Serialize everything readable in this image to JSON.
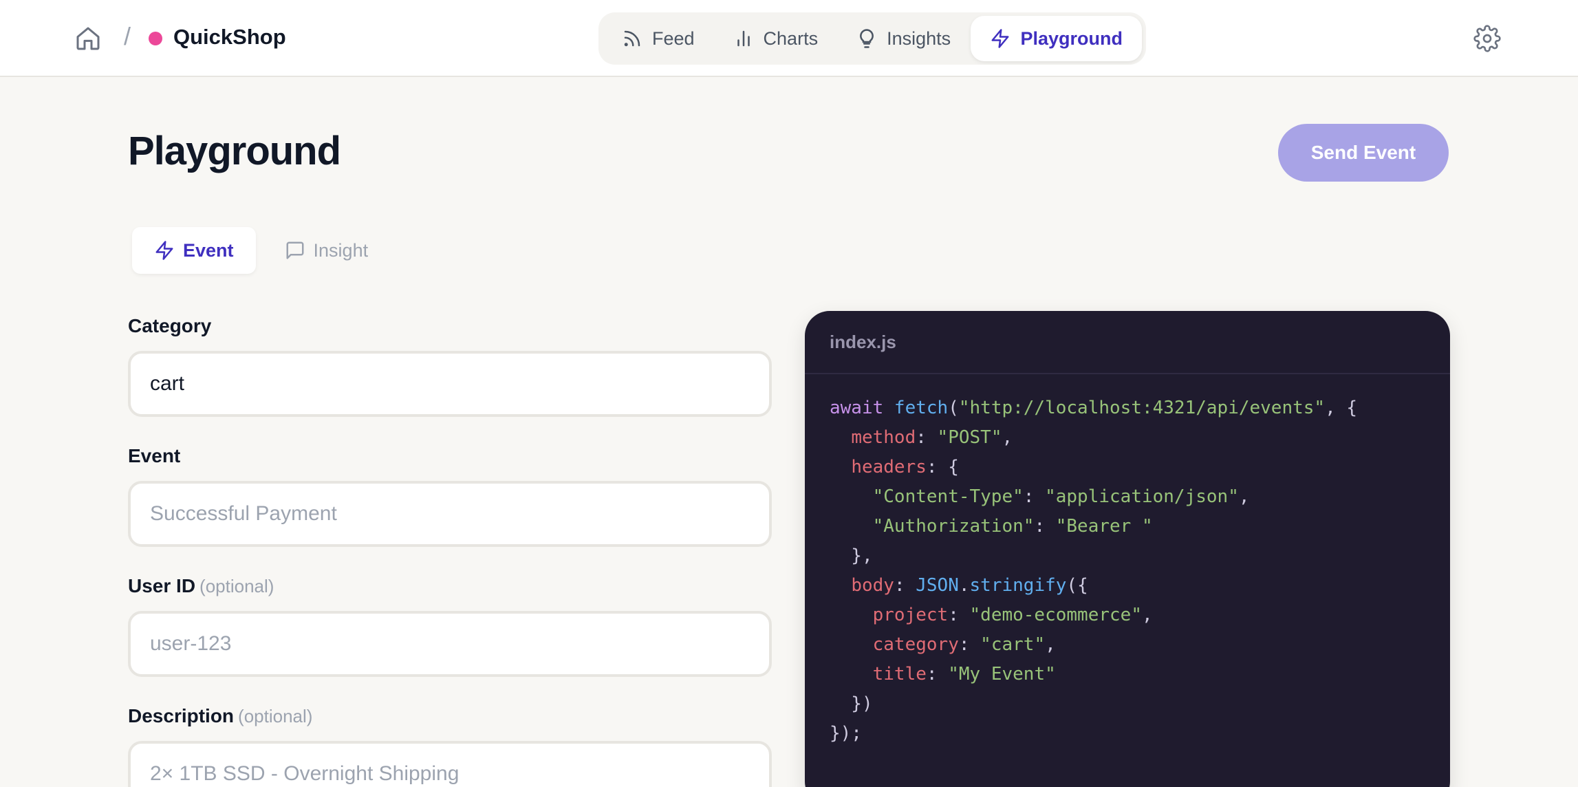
{
  "header": {
    "project_name": "QuickShop",
    "project_color": "#ec4899",
    "separator": "/",
    "nav": [
      {
        "label": "Feed",
        "icon": "rss-icon"
      },
      {
        "label": "Charts",
        "icon": "bar-chart-icon"
      },
      {
        "label": "Insights",
        "icon": "lightbulb-icon"
      },
      {
        "label": "Playground",
        "icon": "bolt-icon",
        "active": true
      }
    ]
  },
  "page": {
    "title": "Playground",
    "send_button": "Send Event",
    "accent_color": "#3f2fbf"
  },
  "tabs": [
    {
      "label": "Event",
      "icon": "bolt-icon",
      "active": true
    },
    {
      "label": "Insight",
      "icon": "message-square-icon",
      "active": false
    }
  ],
  "form": {
    "category": {
      "label": "Category",
      "value": "cart"
    },
    "event": {
      "label": "Event",
      "placeholder": "Successful Payment"
    },
    "user_id": {
      "label": "User ID",
      "optional": "(optional)",
      "placeholder": "user-123"
    },
    "description": {
      "label": "Description",
      "optional": "(optional)",
      "placeholder": "2× 1TB SSD - Overnight Shipping"
    }
  },
  "code": {
    "filename": "index.js",
    "lines": [
      [
        [
          "k",
          "await "
        ],
        [
          "f",
          "fetch"
        ],
        [
          "n",
          "("
        ],
        [
          "s",
          "\"http://localhost:4321/api/events\""
        ],
        [
          "n",
          ", {"
        ]
      ],
      [
        [
          "n",
          "  "
        ],
        [
          "p",
          "method"
        ],
        [
          "n",
          ": "
        ],
        [
          "s",
          "\"POST\""
        ],
        [
          "n",
          ","
        ]
      ],
      [
        [
          "n",
          "  "
        ],
        [
          "p",
          "headers"
        ],
        [
          "n",
          ": {"
        ]
      ],
      [
        [
          "n",
          "    "
        ],
        [
          "s",
          "\"Content-Type\""
        ],
        [
          "n",
          ": "
        ],
        [
          "s",
          "\"application/json\""
        ],
        [
          "n",
          ","
        ]
      ],
      [
        [
          "n",
          "    "
        ],
        [
          "s",
          "\"Authorization\""
        ],
        [
          "n",
          ": "
        ],
        [
          "s",
          "\"Bearer \""
        ]
      ],
      [
        [
          "n",
          "  },"
        ]
      ],
      [
        [
          "n",
          "  "
        ],
        [
          "p",
          "body"
        ],
        [
          "n",
          ": "
        ],
        [
          "f",
          "JSON"
        ],
        [
          "n",
          "."
        ],
        [
          "f",
          "stringify"
        ],
        [
          "n",
          "({"
        ]
      ],
      [
        [
          "n",
          "    "
        ],
        [
          "p",
          "project"
        ],
        [
          "n",
          ": "
        ],
        [
          "s",
          "\"demo-ecommerce\""
        ],
        [
          "n",
          ","
        ]
      ],
      [
        [
          "n",
          "    "
        ],
        [
          "p",
          "category"
        ],
        [
          "n",
          ": "
        ],
        [
          "s",
          "\"cart\""
        ],
        [
          "n",
          ","
        ]
      ],
      [
        [
          "n",
          "    "
        ],
        [
          "p",
          "title"
        ],
        [
          "n",
          ": "
        ],
        [
          "s",
          "\"My Event\""
        ]
      ],
      [
        [
          "n",
          "  })"
        ]
      ],
      [
        [
          "n",
          "});"
        ]
      ]
    ]
  }
}
